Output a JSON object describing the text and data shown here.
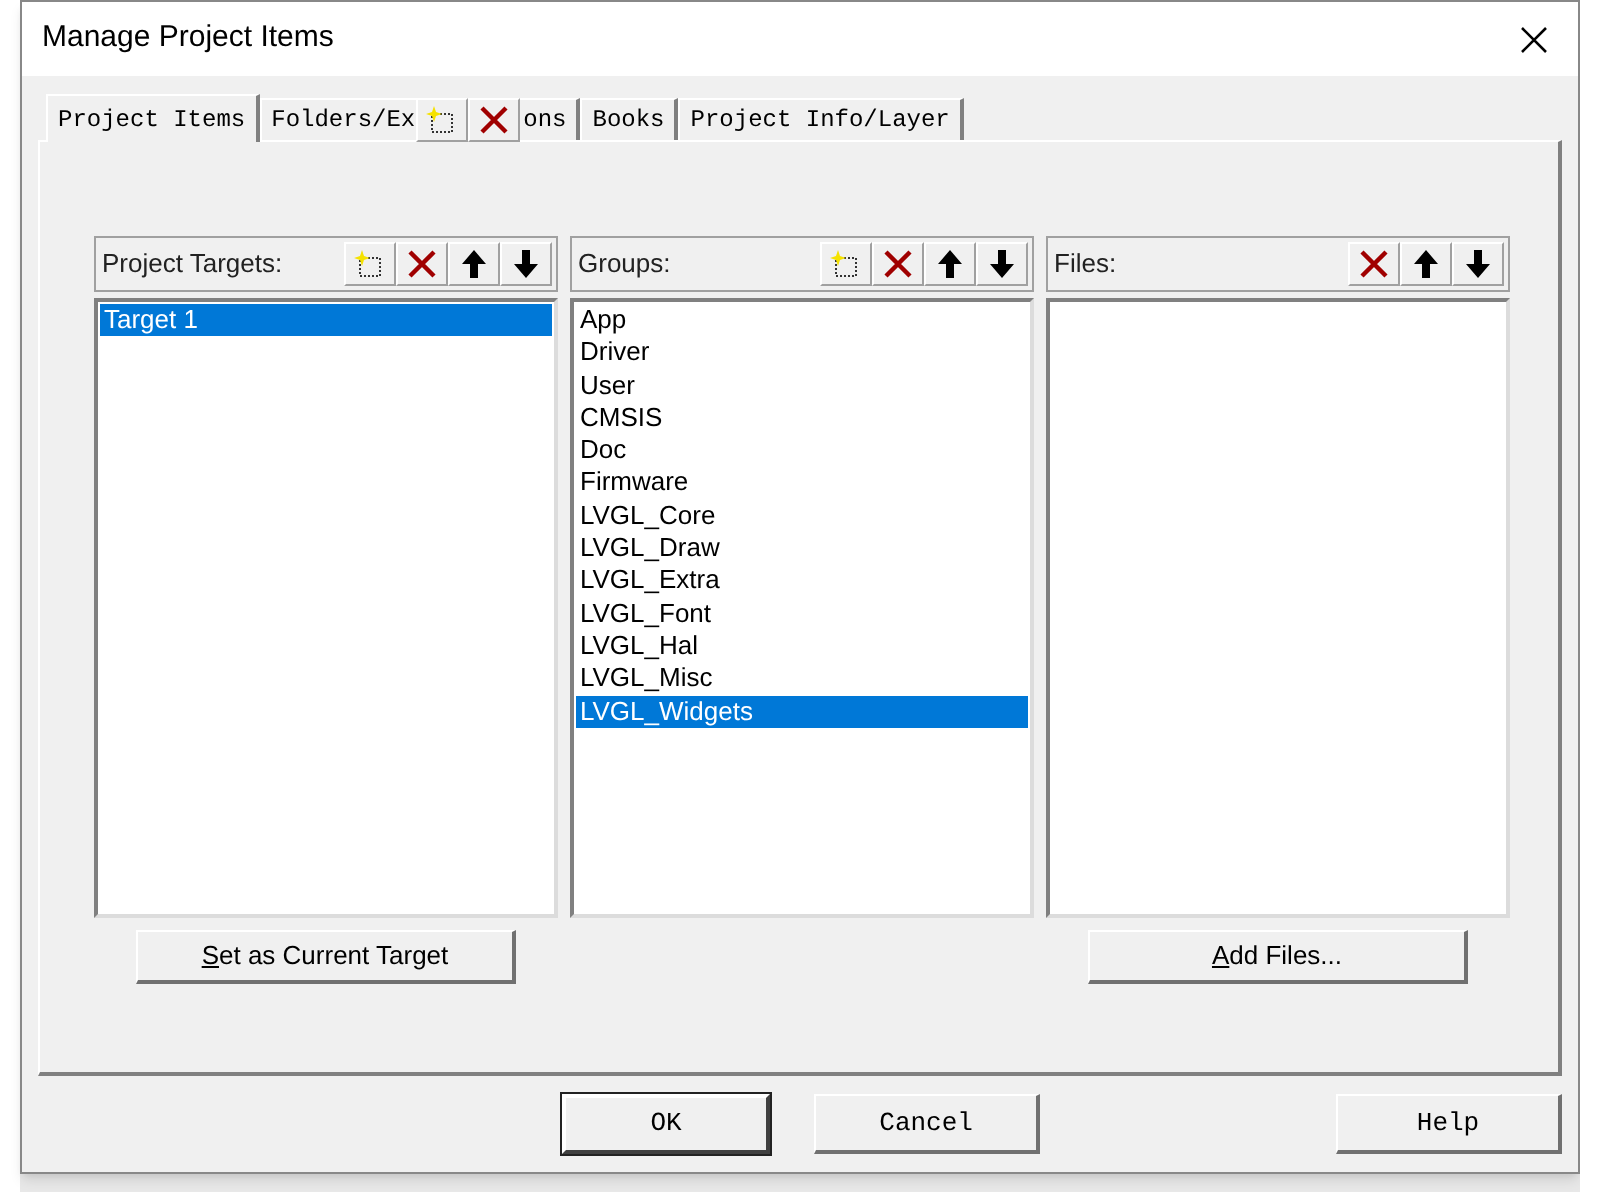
{
  "window": {
    "title": "Manage Project Items"
  },
  "tabs": [
    {
      "label": "Project Items",
      "selected": true
    },
    {
      "label": "Folders/Ex",
      "trailing": "ons",
      "selected": false
    },
    {
      "label": "Books",
      "selected": false
    },
    {
      "label": "Project Info/Layer",
      "selected": false
    }
  ],
  "overlay_toolbar": {
    "tools": [
      {
        "kind": "new"
      },
      {
        "kind": "delete"
      }
    ]
  },
  "panels": [
    {
      "title": "Project Targets:",
      "tools": [
        {
          "kind": "new"
        },
        {
          "kind": "delete"
        },
        {
          "kind": "up"
        },
        {
          "kind": "down"
        }
      ],
      "items": [
        {
          "label": "Target 1",
          "selected": true
        }
      ],
      "button": {
        "label": "Set as Current Target",
        "underline_first": true
      }
    },
    {
      "title": "Groups:",
      "tools": [
        {
          "kind": "new"
        },
        {
          "kind": "delete"
        },
        {
          "kind": "up"
        },
        {
          "kind": "down"
        }
      ],
      "items": [
        {
          "label": "App",
          "selected": false
        },
        {
          "label": "Driver",
          "selected": false
        },
        {
          "label": "User",
          "selected": false
        },
        {
          "label": "CMSIS",
          "selected": false
        },
        {
          "label": "Doc",
          "selected": false
        },
        {
          "label": "Firmware",
          "selected": false
        },
        {
          "label": "LVGL_Core",
          "selected": false
        },
        {
          "label": "LVGL_Draw",
          "selected": false
        },
        {
          "label": "LVGL_Extra",
          "selected": false
        },
        {
          "label": "LVGL_Font",
          "selected": false
        },
        {
          "label": "LVGL_Hal",
          "selected": false
        },
        {
          "label": "LVGL_Misc",
          "selected": false
        },
        {
          "label": "LVGL_Widgets",
          "selected": true
        }
      ]
    },
    {
      "title": "Files:",
      "tools": [
        {
          "kind": "delete"
        },
        {
          "kind": "up"
        },
        {
          "kind": "down"
        }
      ],
      "button": {
        "label": "Add Files...",
        "underline_first": true
      }
    }
  ],
  "buttons": [
    {
      "label": "OK",
      "default": true
    },
    {
      "label": "Cancel",
      "default": false
    },
    {
      "label": "Help",
      "default": false
    }
  ]
}
